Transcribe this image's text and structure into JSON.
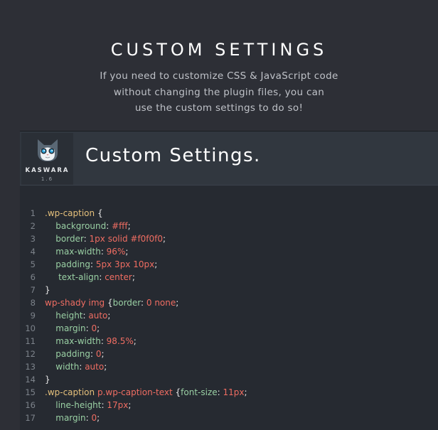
{
  "hero": {
    "title": "CUSTOM SETTINGS",
    "description_lines": [
      "If you need to customize CSS & JavaScript code",
      "without changing the plugin files, you can",
      "use the custom settings to do so!"
    ]
  },
  "window": {
    "logo": {
      "icon": "cat-mascot-icon",
      "name": "KASWARA",
      "version": "1.6"
    },
    "title": "Custom Settings."
  },
  "code_lines": [
    {
      "n": "1",
      "tokens": [
        {
          "t": ".wp-caption ",
          "c": "sel"
        },
        {
          "t": "{",
          "c": "punct"
        }
      ]
    },
    {
      "n": "2",
      "tokens": [
        {
          "t": "    background",
          "c": "prop"
        },
        {
          "t": ": ",
          "c": "punct"
        },
        {
          "t": "#fff",
          "c": "val"
        },
        {
          "t": ";",
          "c": "punct"
        }
      ]
    },
    {
      "n": "3",
      "tokens": [
        {
          "t": "    border",
          "c": "prop"
        },
        {
          "t": ": ",
          "c": "punct"
        },
        {
          "t": "1px solid #f0f0f0",
          "c": "val"
        },
        {
          "t": ";",
          "c": "punct"
        }
      ]
    },
    {
      "n": "4",
      "tokens": [
        {
          "t": "    max-width",
          "c": "prop"
        },
        {
          "t": ": ",
          "c": "punct"
        },
        {
          "t": "96%",
          "c": "val"
        },
        {
          "t": ";",
          "c": "punct"
        }
      ]
    },
    {
      "n": "5",
      "tokens": [
        {
          "t": "    padding",
          "c": "prop"
        },
        {
          "t": ": ",
          "c": "punct"
        },
        {
          "t": "5px 3px 10px",
          "c": "val"
        },
        {
          "t": ";",
          "c": "punct"
        }
      ]
    },
    {
      "n": "6",
      "tokens": [
        {
          "t": "     text-align",
          "c": "prop"
        },
        {
          "t": ": ",
          "c": "punct"
        },
        {
          "t": "center",
          "c": "val"
        },
        {
          "t": ";",
          "c": "punct"
        }
      ]
    },
    {
      "n": "7",
      "tokens": [
        {
          "t": "}",
          "c": "punct"
        }
      ]
    },
    {
      "n": "8",
      "tokens": [
        {
          "t": "wp-shady img ",
          "c": "sel2"
        },
        {
          "t": "{",
          "c": "punct"
        },
        {
          "t": "border",
          "c": "prop"
        },
        {
          "t": ": ",
          "c": "punct"
        },
        {
          "t": "0 none",
          "c": "val"
        },
        {
          "t": ";",
          "c": "punct"
        }
      ]
    },
    {
      "n": "9",
      "tokens": [
        {
          "t": "    height",
          "c": "prop"
        },
        {
          "t": ": ",
          "c": "punct"
        },
        {
          "t": "auto",
          "c": "val"
        },
        {
          "t": ";",
          "c": "punct"
        }
      ]
    },
    {
      "n": "10",
      "tokens": [
        {
          "t": "    margin",
          "c": "prop"
        },
        {
          "t": ": ",
          "c": "punct"
        },
        {
          "t": "0",
          "c": "val"
        },
        {
          "t": ";",
          "c": "punct"
        }
      ]
    },
    {
      "n": "11",
      "tokens": [
        {
          "t": "    max-width",
          "c": "prop"
        },
        {
          "t": ": ",
          "c": "punct"
        },
        {
          "t": "98.5%",
          "c": "val"
        },
        {
          "t": ";",
          "c": "punct"
        }
      ]
    },
    {
      "n": "12",
      "tokens": [
        {
          "t": "    padding",
          "c": "prop"
        },
        {
          "t": ": ",
          "c": "punct"
        },
        {
          "t": "0",
          "c": "val"
        },
        {
          "t": ";",
          "c": "punct"
        }
      ]
    },
    {
      "n": "13",
      "tokens": [
        {
          "t": "    width",
          "c": "prop"
        },
        {
          "t": ": ",
          "c": "punct"
        },
        {
          "t": "auto",
          "c": "val"
        },
        {
          "t": ";",
          "c": "punct"
        }
      ]
    },
    {
      "n": "14",
      "tokens": [
        {
          "t": "}",
          "c": "punct"
        }
      ]
    },
    {
      "n": "15",
      "tokens": [
        {
          "t": ".wp-caption ",
          "c": "sel"
        },
        {
          "t": "p.wp-caption-text ",
          "c": "sel2"
        },
        {
          "t": "{",
          "c": "punct"
        },
        {
          "t": "font-size",
          "c": "prop"
        },
        {
          "t": ": ",
          "c": "punct"
        },
        {
          "t": "11px",
          "c": "val"
        },
        {
          "t": ";",
          "c": "punct"
        }
      ]
    },
    {
      "n": "16",
      "tokens": [
        {
          "t": "    line-height",
          "c": "prop"
        },
        {
          "t": ": ",
          "c": "punct"
        },
        {
          "t": "17px",
          "c": "val"
        },
        {
          "t": ";",
          "c": "punct"
        }
      ]
    },
    {
      "n": "17",
      "tokens": [
        {
          "t": "    margin",
          "c": "prop"
        },
        {
          "t": ": ",
          "c": "punct"
        },
        {
          "t": "0",
          "c": "val"
        },
        {
          "t": ";",
          "c": "punct"
        }
      ]
    }
  ]
}
